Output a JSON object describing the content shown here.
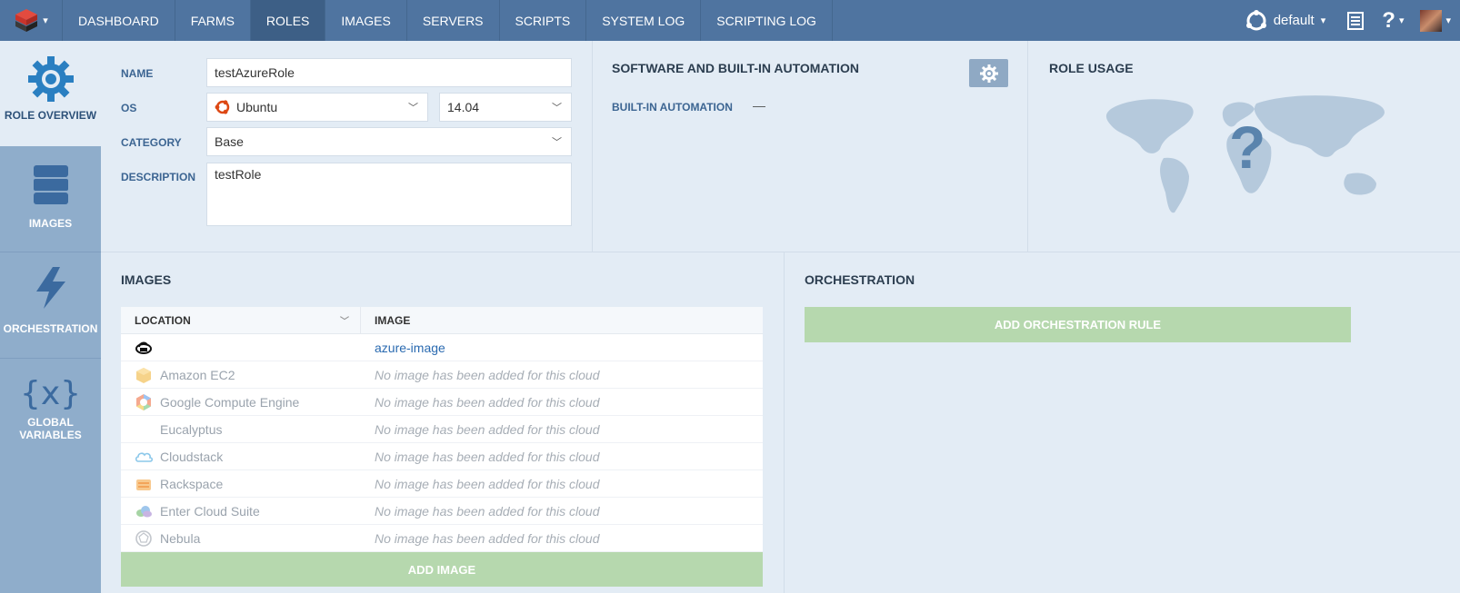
{
  "nav": {
    "items": [
      {
        "label": "DASHBOARD"
      },
      {
        "label": "FARMS"
      },
      {
        "label": "ROLES"
      },
      {
        "label": "IMAGES"
      },
      {
        "label": "SERVERS"
      },
      {
        "label": "SCRIPTS"
      },
      {
        "label": "SYSTEM LOG"
      },
      {
        "label": "SCRIPTING LOG"
      }
    ],
    "active": "ROLES",
    "environment": "default"
  },
  "sidebar": {
    "items": [
      {
        "label": "ROLE OVERVIEW",
        "icon": "gear-icon"
      },
      {
        "label": "IMAGES",
        "icon": "stack-icon"
      },
      {
        "label": "ORCHESTRATION",
        "icon": "lightning-icon"
      },
      {
        "label_line1": "GLOBAL",
        "label_line2": "VARIABLES",
        "icon": "variables-icon",
        "glyph": "{x}"
      }
    ]
  },
  "role": {
    "name_label": "NAME",
    "name_value": "testAzureRole",
    "os_label": "OS",
    "os_value": "Ubuntu",
    "os_version": "14.04",
    "category_label": "CATEGORY",
    "category_value": "Base",
    "description_label": "DESCRIPTION",
    "description_value": "testRole"
  },
  "software": {
    "title": "SOFTWARE AND BUILT-IN AUTOMATION",
    "builtin_label": "BUILT-IN AUTOMATION",
    "builtin_value": "—"
  },
  "usage": {
    "title": "ROLE USAGE",
    "unknown_glyph": "?"
  },
  "images": {
    "title": "IMAGES",
    "columns": {
      "location": "LOCATION",
      "image": "IMAGE"
    },
    "rows": [
      {
        "cloud": "",
        "icon": "azure-icon",
        "image": "azure-image"
      },
      {
        "cloud": "Amazon EC2",
        "icon": "amazon-ec2-icon",
        "image": "No image has been added for this cloud"
      },
      {
        "cloud": "Google Compute Engine",
        "icon": "google-compute-icon",
        "image": "No image has been added for this cloud"
      },
      {
        "cloud": "Eucalyptus",
        "icon": "",
        "image": "No image has been added for this cloud"
      },
      {
        "cloud": "Cloudstack",
        "icon": "cloudstack-icon",
        "image": "No image has been added for this cloud"
      },
      {
        "cloud": "Rackspace",
        "icon": "rackspace-icon",
        "image": "No image has been added for this cloud"
      },
      {
        "cloud": "Enter Cloud Suite",
        "icon": "enter-cloud-suite-icon",
        "image": "No image has been added for this cloud"
      },
      {
        "cloud": "Nebula",
        "icon": "nebula-icon",
        "image": "No image has been added for this cloud"
      }
    ],
    "add_button": "ADD IMAGE"
  },
  "orchestration": {
    "title": "ORCHESTRATION",
    "add_button": "ADD ORCHESTRATION RULE"
  },
  "colors": {
    "topbar": "#4f74a0",
    "sidebar": "#8fadcb",
    "background": "#e3ecf5",
    "accent_green": "#b6d8ae",
    "link": "#2a6ab0"
  }
}
